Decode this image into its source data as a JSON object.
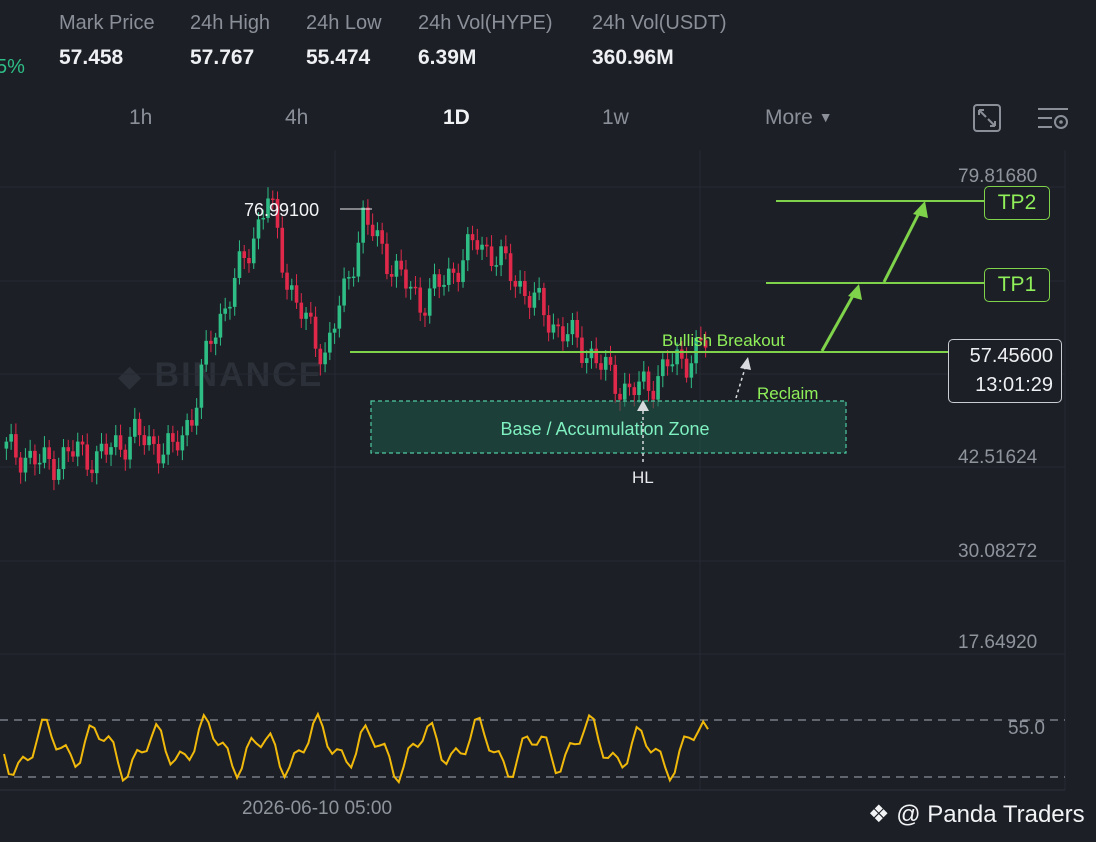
{
  "header": {
    "change_fragment": "5%",
    "stats": [
      {
        "label": "Mark Price",
        "value": "57.458"
      },
      {
        "label": "24h High",
        "value": "57.767"
      },
      {
        "label": "24h Low",
        "value": "55.474"
      },
      {
        "label": "24h Vol(HYPE)",
        "value": "6.39M"
      },
      {
        "label": "24h Vol(USDT)",
        "value": "360.96M"
      }
    ]
  },
  "timeframes": [
    "1h",
    "4h",
    "1D",
    "1w"
  ],
  "active_timeframe": "1D",
  "more_label": "More",
  "toolbar_icons": [
    "fullscreen-icon",
    "indicator-settings-icon"
  ],
  "watermark": "BINANCE",
  "price_axis": [
    "79.81680",
    "42.51624",
    "30.08272",
    "17.64920"
  ],
  "indicator_axis": [
    "55.0"
  ],
  "current_price": {
    "value": "57.45600",
    "countdown": "13:01:29"
  },
  "peak_label": "76.99100",
  "annotations": {
    "bullish_breakout": "Bullish Breakout",
    "reclaim": "Reclaim",
    "zone": "Base / Accumulation Zone",
    "hl": "HL",
    "tp1": "TP1",
    "tp2": "TP2"
  },
  "date_label": "2026-06-10 05:00",
  "credit": "@ Panda Traders",
  "colors": {
    "up": "#2ebd85",
    "down": "#e0294a",
    "annotation_green": "#7fd34a",
    "rsi": "#f0b90b",
    "zone_fill": "#1f5a4a"
  },
  "chart_data": {
    "type": "line",
    "title": "",
    "y_ticks": [
      79.8168,
      42.51624,
      30.08272,
      17.6492
    ],
    "last_price": 57.456,
    "peak": 76.991,
    "series": [
      {
        "name": "",
        "values": [
          43.5,
          42.8,
          41.5,
          42.0,
          43.2,
          42.1,
          44.0,
          45.2,
          44.1,
          43.0,
          48.0,
          58.0,
          64.0,
          70.0,
          76.991,
          66.0,
          60.0,
          56.0,
          64.0,
          74.0,
          70.0,
          66.0,
          63.0,
          65.0,
          68.0,
          71.0,
          69.0,
          66.0,
          63.0,
          60.0,
          58.0,
          56.0,
          53.0,
          51.0,
          52.0,
          54.5,
          55.5,
          57.456
        ]
      }
    ]
  }
}
